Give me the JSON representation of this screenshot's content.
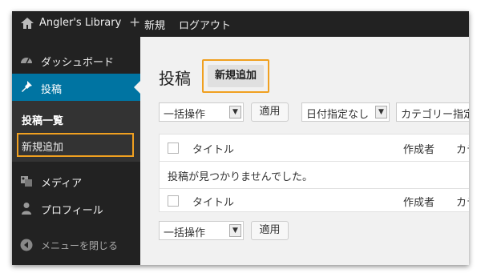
{
  "admin_bar": {
    "site_title": "Angler's Library",
    "new_label": "新規",
    "logout_label": "ログアウト"
  },
  "sidebar": {
    "items": [
      {
        "label": "ダッシュボード",
        "icon": "dashboard-icon"
      },
      {
        "label": "投稿",
        "icon": "pin-icon",
        "current": true
      },
      {
        "label": "メディア",
        "icon": "media-icon"
      },
      {
        "label": "プロフィール",
        "icon": "user-icon"
      }
    ],
    "submenu": {
      "current_label": "投稿一覧",
      "add_new_label": "新規追加"
    },
    "collapse_label": "メニューを閉じる"
  },
  "main": {
    "title": "投稿",
    "add_new_button": "新規追加",
    "bulk_action_top": "一括操作",
    "apply_top": "適用",
    "date_filter": "日付指定なし",
    "category_filter": "カテゴリー指定",
    "table": {
      "col_title": "タイトル",
      "col_author": "作成者",
      "col_category": "カテゴリー",
      "empty_message": "投稿が見つかりませんでした。"
    },
    "bulk_action_bottom": "一括操作",
    "apply_bottom": "適用"
  },
  "colors": {
    "admin_bar_bg": "#222222",
    "sidebar_bg": "#222222",
    "current_menu_bg": "#0074a2",
    "highlight_border": "#f0a020"
  }
}
